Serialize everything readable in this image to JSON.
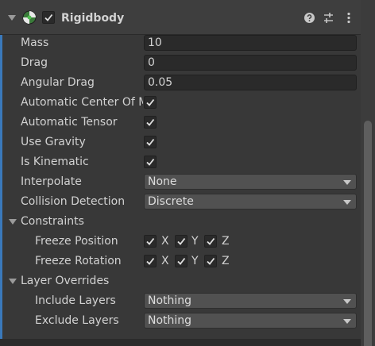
{
  "component": {
    "title": "Rigidbody",
    "icon": "rigidbody-physics-icon",
    "header_icons": [
      "help-icon",
      "preset-sliders-icon",
      "more-vertical-icon"
    ],
    "enabled_expanded": true
  },
  "properties": {
    "mass": {
      "label": "Mass",
      "value": "10"
    },
    "drag": {
      "label": "Drag",
      "value": "0"
    },
    "angular_drag": {
      "label": "Angular Drag",
      "value": "0.05"
    },
    "automatic_center_of_mass": {
      "label": "Automatic Center Of M",
      "checked": true
    },
    "automatic_tensor": {
      "label": "Automatic Tensor",
      "checked": true
    },
    "use_gravity": {
      "label": "Use Gravity",
      "checked": true
    },
    "is_kinematic": {
      "label": "Is Kinematic",
      "checked": false
    },
    "interpolate": {
      "label": "Interpolate",
      "value": "None"
    },
    "collision_detection": {
      "label": "Collision Detection",
      "value": "Discrete"
    }
  },
  "constraints": {
    "label": "Constraints",
    "freeze_position": {
      "label": "Freeze Position",
      "x": {
        "label": "X",
        "checked": false
      },
      "y": {
        "label": "Y",
        "checked": false
      },
      "z": {
        "label": "Z",
        "checked": false
      }
    },
    "freeze_rotation": {
      "label": "Freeze Rotation",
      "x": {
        "label": "X",
        "checked": true
      },
      "y": {
        "label": "Y",
        "checked": false
      },
      "z": {
        "label": "Z",
        "checked": true
      }
    }
  },
  "layer_overrides": {
    "label": "Layer Overrides",
    "include_layers": {
      "label": "Include Layers",
      "value": "Nothing"
    },
    "exclude_layers": {
      "label": "Exclude Layers",
      "value": "Nothing"
    }
  },
  "colors": {
    "panel_bg": "#383838",
    "header_bg": "#3e3e3e",
    "accent": "#3a79bb",
    "field_bg": "#2a2a2a",
    "dropdown_bg": "#515151",
    "text": "#d2d2d2"
  }
}
